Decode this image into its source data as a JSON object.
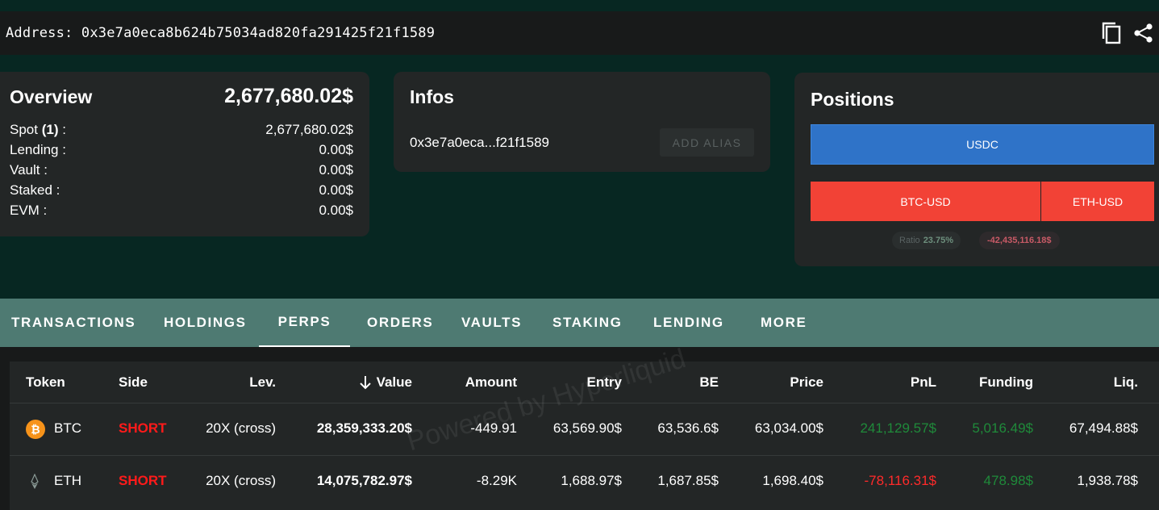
{
  "address_bar": {
    "text": "Address: 0x3e7a0eca8b624b75034ad820fa291425f21f1589",
    "icons": [
      "copy-icon",
      "share-icon"
    ]
  },
  "overview": {
    "title": "Overview",
    "total": "2,677,680.02$",
    "rows": [
      {
        "label": "Spot ",
        "count": "(1)",
        "suffix": " :",
        "value": "2,677,680.02$"
      },
      {
        "label": "Lending :",
        "value": "0.00$"
      },
      {
        "label": "Vault :",
        "value": "0.00$"
      },
      {
        "label": "Staked :",
        "value": "0.00$"
      },
      {
        "label": "EVM :",
        "value": "0.00$"
      }
    ]
  },
  "infos": {
    "title": "Infos",
    "short_address": "0x3e7a0eca...f21f1589",
    "alias_button": "ADD ALIAS"
  },
  "positions": {
    "title": "Positions",
    "usdc_label": "USDC",
    "btc_label": "BTC-USD",
    "eth_label": "ETH-USD",
    "ratio_label": "Ratio",
    "ratio_value": "23.75%",
    "pnl_value": "-42,435,116.18$",
    "colors": {
      "usdc": "#2f73c8",
      "short": "#f24236"
    }
  },
  "tabs": [
    "TRANSACTIONS",
    "HOLDINGS",
    "PERPS",
    "ORDERS",
    "VAULTS",
    "STAKING",
    "LENDING",
    "MORE"
  ],
  "active_tab": "PERPS",
  "table": {
    "headers": [
      "Token",
      "Side",
      "Lev.",
      "Value",
      "Amount",
      "Entry",
      "BE",
      "Price",
      "PnL",
      "Funding",
      "Liq."
    ],
    "sort_icon": "arrow-down-icon",
    "rows": [
      {
        "token": "BTC",
        "side": "SHORT",
        "lev": "20X (cross)",
        "value": "28,359,333.20$",
        "amount": "-449.91",
        "entry": "63,569.90$",
        "be": "63,536.6$",
        "price": "63,034.00$",
        "pnl": "241,129.57$",
        "funding": "5,016.49$",
        "liq": "67,494.88$"
      },
      {
        "token": "ETH",
        "side": "SHORT",
        "lev": "20X (cross)",
        "value": "14,075,782.97$",
        "amount": "-8.29K",
        "entry": "1,688.97$",
        "be": "1,687.85$",
        "price": "1,698.40$",
        "pnl": "-78,116.31$",
        "funding": "478.98$",
        "liq": "1,938.78$"
      }
    ]
  },
  "watermark": "Powered by Hyperliquid"
}
